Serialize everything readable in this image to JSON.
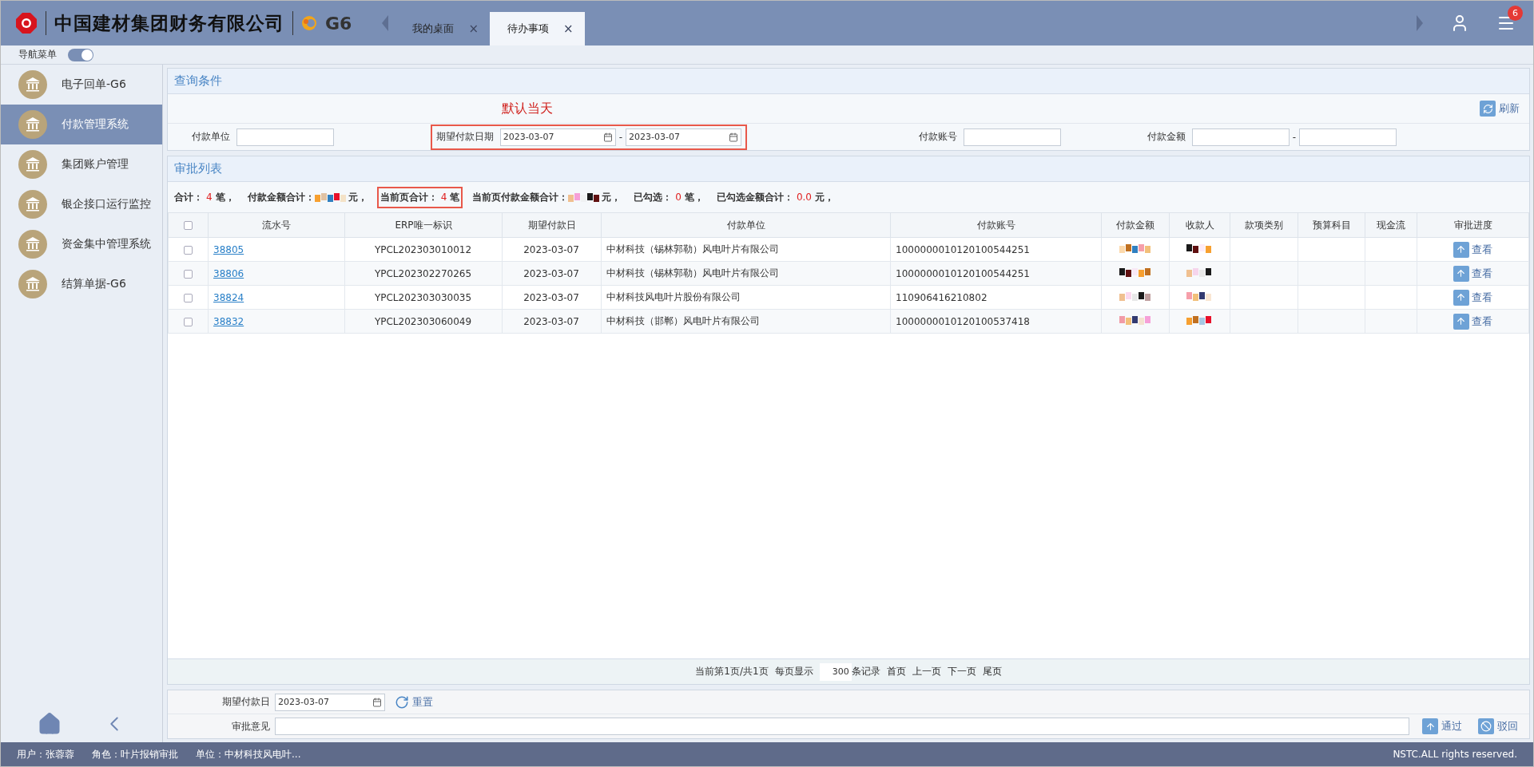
{
  "header": {
    "company": "中国建材集团财务有限公司",
    "product": "G6",
    "tabs": [
      {
        "label": "我的桌面",
        "selected": false,
        "close": "×"
      },
      {
        "label": "待办事项",
        "selected": true,
        "close": "×"
      }
    ],
    "notification_count": "6"
  },
  "nav_toggle": {
    "label": "导航菜单",
    "on": true
  },
  "sidebar": {
    "items": [
      {
        "label": "电子回单-G6",
        "selected": false
      },
      {
        "label": "付款管理系统",
        "selected": true
      },
      {
        "label": "集团账户管理",
        "selected": false
      },
      {
        "label": "银企接口运行监控",
        "selected": false
      },
      {
        "label": "资金集中管理系统",
        "selected": false
      },
      {
        "label": "结算单据-G6",
        "selected": false
      }
    ]
  },
  "query": {
    "title": "查询条件",
    "annotation": "默认当天",
    "refresh": "刷新",
    "fields": [
      {
        "kind": "text",
        "label": "付款单位",
        "highlighted": false
      },
      {
        "kind": "daterange",
        "label": "期望付款日期",
        "from": "2023-03-07",
        "separator": "-",
        "to": "2023-03-07",
        "highlighted": true
      },
      {
        "kind": "text",
        "label": "付款账号",
        "highlighted": false
      },
      {
        "kind": "range",
        "label": "付款金额",
        "separator": "-",
        "highlighted": false
      }
    ]
  },
  "list": {
    "title": "审批列表",
    "select_all_checked": false,
    "summary": [
      {
        "kind": "count",
        "label": "合计：",
        "value": "4",
        "unit": "笔，",
        "highlighted": false
      },
      {
        "kind": "redacted",
        "label": "付款金额合计：",
        "unit": "元，",
        "highlighted": false
      },
      {
        "kind": "count",
        "label": "当前页合计：",
        "value": "4",
        "unit": "笔",
        "highlighted": true
      },
      {
        "kind": "redacted",
        "label": "当前页付款金额合计：",
        "unit": "元，",
        "highlighted": false
      },
      {
        "kind": "count",
        "label": "已勾选：",
        "value": "0",
        "unit": "笔，",
        "highlighted": false
      },
      {
        "kind": "count",
        "label": "已勾选金额合计：",
        "value": "0.0",
        "unit": "元，",
        "highlighted": false
      }
    ],
    "columns": [
      {
        "label": "流水号",
        "kind": "link"
      },
      {
        "label": "ERP唯一标识",
        "kind": "text"
      },
      {
        "label": "期望付款日",
        "kind": "text"
      },
      {
        "label": "付款单位",
        "kind": "text"
      },
      {
        "label": "付款账号",
        "kind": "text"
      },
      {
        "label": "付款金额",
        "kind": "redacted"
      },
      {
        "label": "收款人",
        "kind": "redacted"
      },
      {
        "label": "款项类别",
        "kind": "blank"
      },
      {
        "label": "预算科目",
        "kind": "blank"
      },
      {
        "label": "现金流",
        "kind": "blank"
      },
      {
        "label": "审批进度",
        "kind": "action"
      }
    ],
    "rows": [
      {
        "checked": false,
        "cells": [
          "38805",
          "YPCL202303010012",
          "2023-03-07",
          "中材科技（锡林郭勒）风电叶片有限公司",
          "1000000010120100544251"
        ],
        "action": "查看"
      },
      {
        "checked": false,
        "cells": [
          "38806",
          "YPCL202302270265",
          "2023-03-07",
          "中材科技（锡林郭勒）风电叶片有限公司",
          "1000000010120100544251"
        ],
        "action": "查看"
      },
      {
        "checked": false,
        "cells": [
          "38824",
          "YPCL202303030035",
          "2023-03-07",
          "中材科技风电叶片股份有限公司",
          "110906416210802"
        ],
        "action": "查看"
      },
      {
        "checked": false,
        "cells": [
          "38832",
          "YPCL202303060049",
          "2023-03-07",
          "中材科技（邯郸）风电叶片有限公司",
          "1000000010120100537418"
        ],
        "action": "查看"
      }
    ],
    "pagination": {
      "page_info": "当前第1页/共1页",
      "per_page_label": "每页显示",
      "per_page": "300",
      "per_page_unit": "条记录",
      "links": [
        "首页",
        "上一页",
        "下一页",
        "尾页"
      ]
    }
  },
  "approval": {
    "date_label": "期望付款日",
    "date": "2023-03-07",
    "reset": "重置",
    "opinion_label": "审批意见",
    "buttons": [
      {
        "kind": "approve",
        "label": "通过"
      },
      {
        "kind": "reject",
        "label": "驳回"
      }
    ]
  },
  "status_bar": {
    "user": "用户：张蓉蓉",
    "role": "角色：叶片报销审批",
    "unit": "单位：中材科技风电叶...",
    "copyright": "NSTC.ALL rights reserved."
  }
}
